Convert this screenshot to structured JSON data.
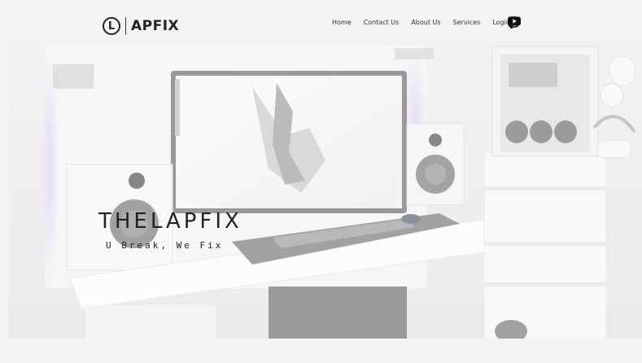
{
  "brand": {
    "logo_letter": "L",
    "name": "APFIX"
  },
  "nav": {
    "home": "Home",
    "contact": "Contact Us",
    "about": "About Us",
    "services": "Services",
    "login": "Login"
  },
  "social": [
    "facebook-icon",
    "instagram-icon",
    "youtube-icon"
  ],
  "hero": {
    "title": "THELAPFIX",
    "tagline": "U Break, We Fix"
  },
  "colors": {
    "text": "#222222",
    "glow": "#d8c6f4",
    "background": "#f4f4f4"
  }
}
